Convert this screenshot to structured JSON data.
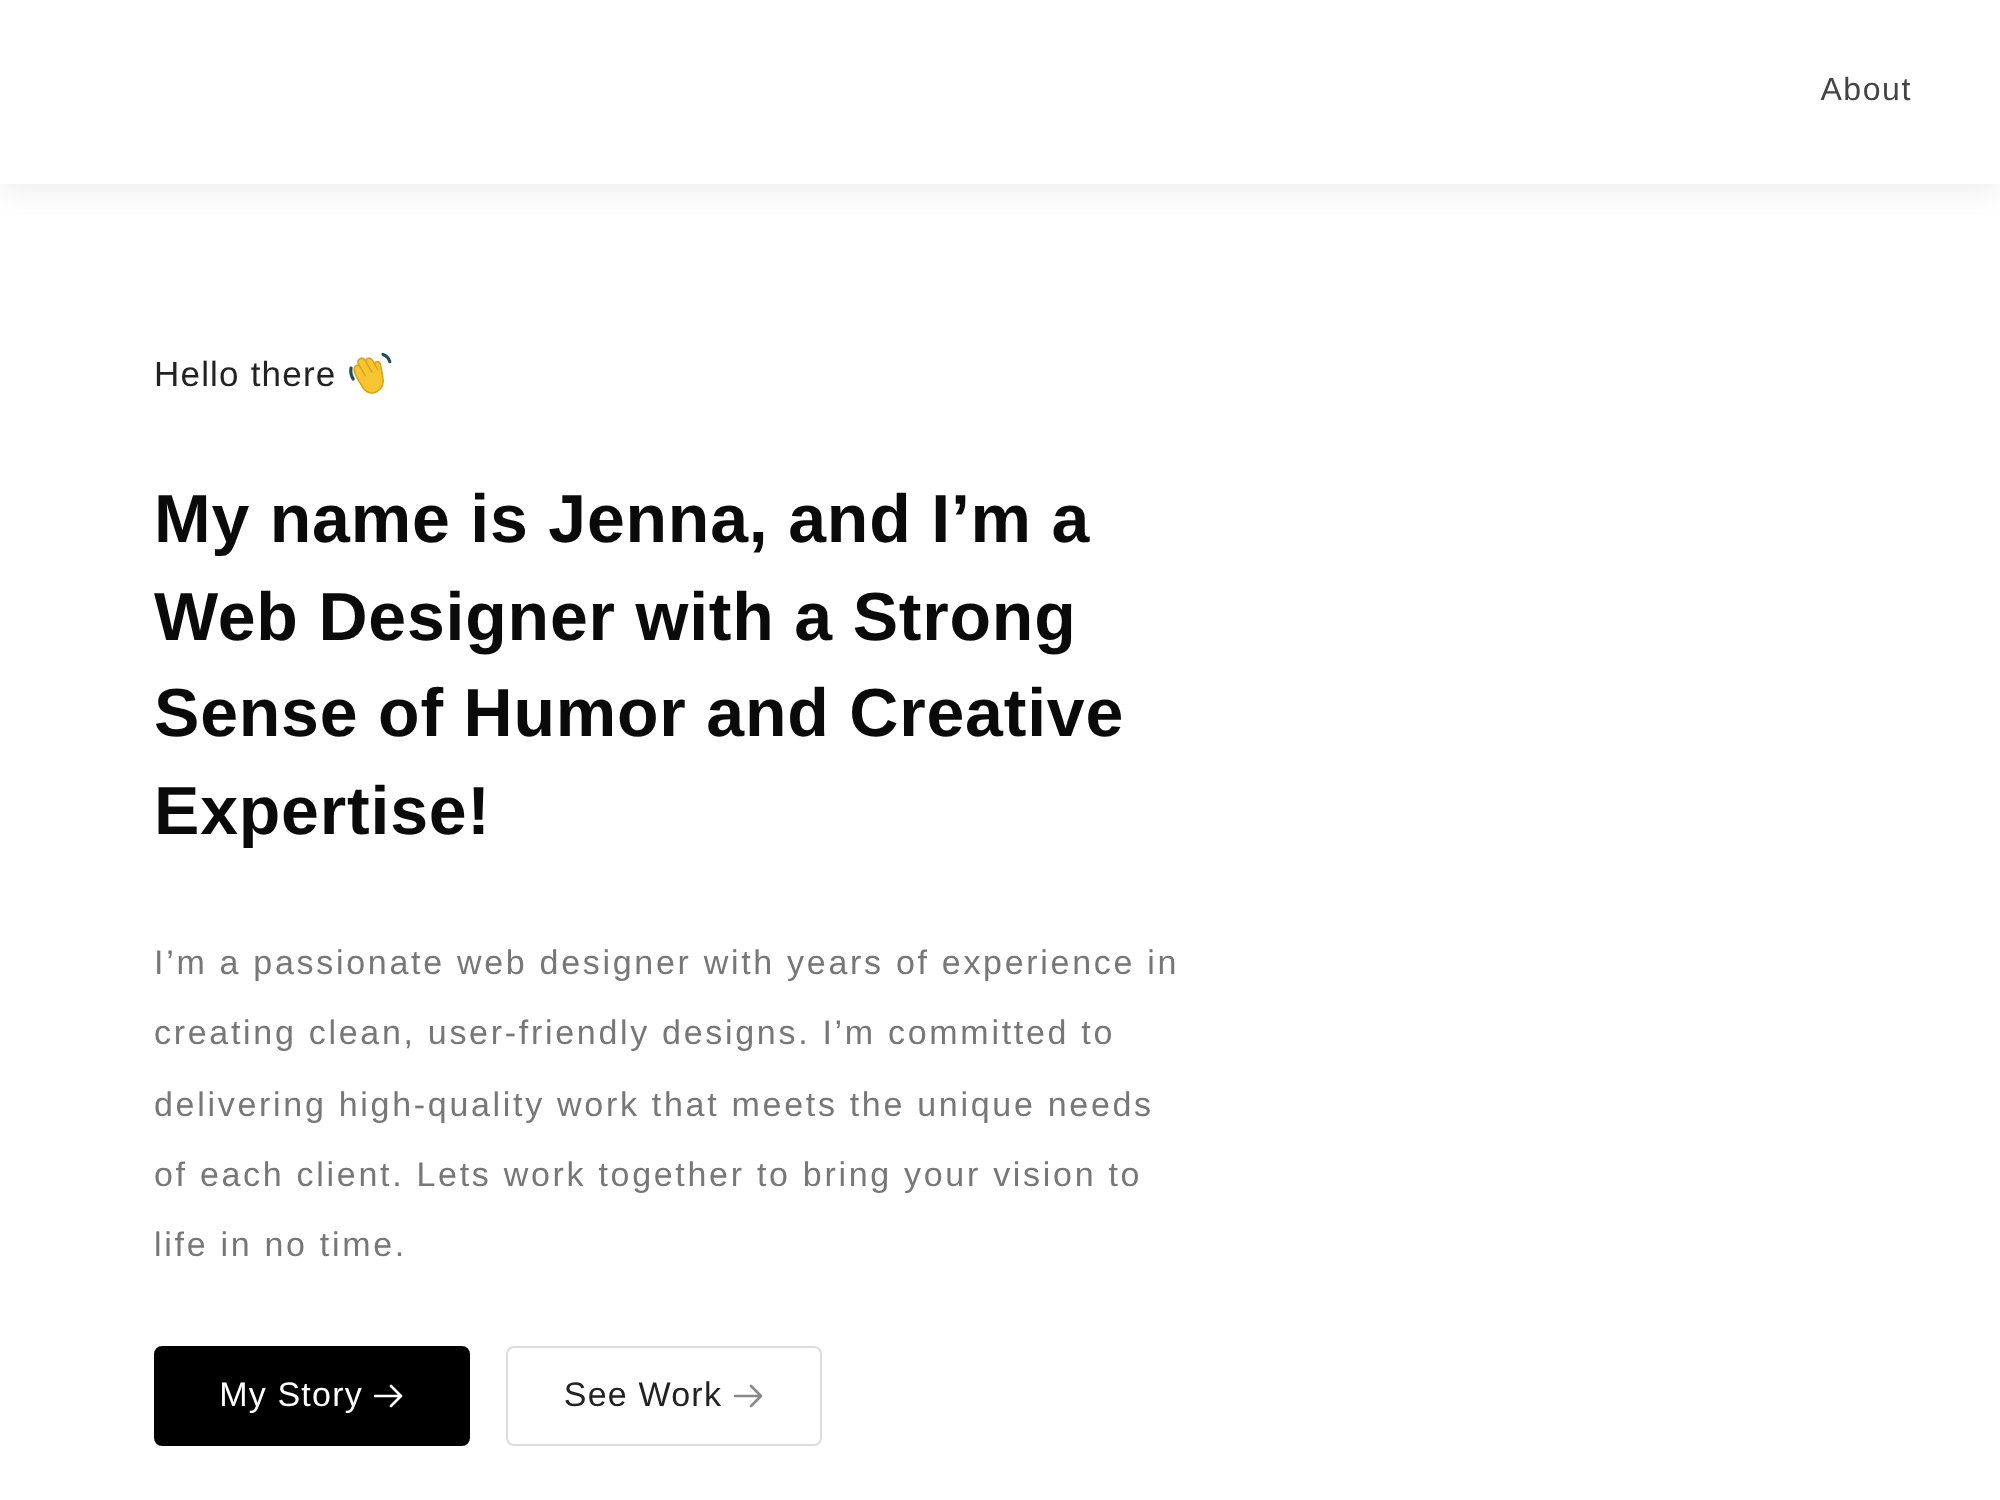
{
  "nav": {
    "links": [
      {
        "label": "About"
      }
    ]
  },
  "hero": {
    "greeting": "Hello there",
    "heading": "My name is Jenna, and I’m a Web Designer with a Strong Sense of Humor and Creative Expertise!",
    "description": "I’m a passionate web designer with years of experience in creating clean, user-friendly designs. I’m committed to delivering high-quality work that meets the unique needs of each client. Lets work together to bring your vision to life in no time.",
    "buttons": [
      {
        "label": "My Story",
        "kind": "primary"
      },
      {
        "label": "See Work",
        "kind": "secondary"
      }
    ]
  }
}
